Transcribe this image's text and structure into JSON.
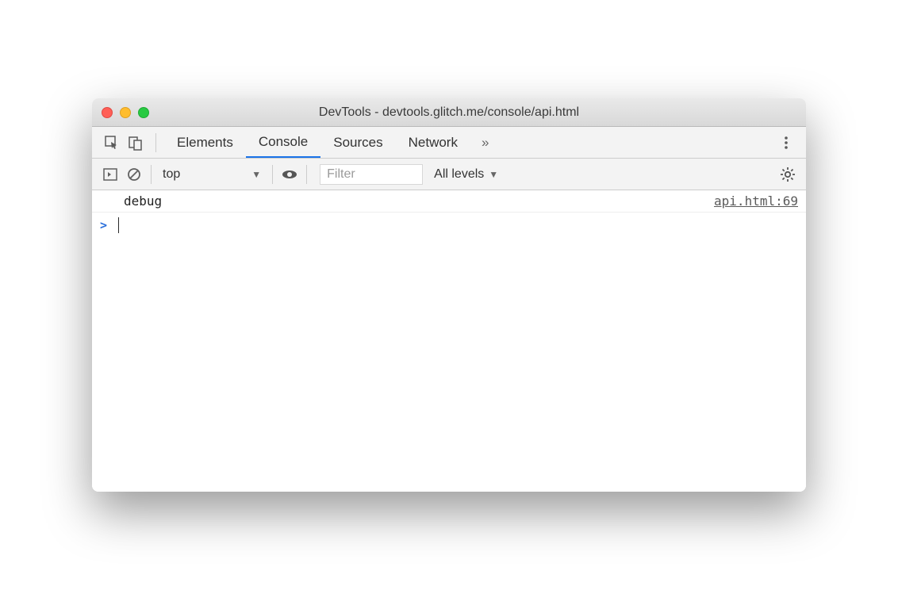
{
  "window": {
    "title": "DevTools - devtools.glitch.me/console/api.html"
  },
  "tabs": {
    "items": [
      {
        "label": "Elements",
        "active": false
      },
      {
        "label": "Console",
        "active": true
      },
      {
        "label": "Sources",
        "active": false
      },
      {
        "label": "Network",
        "active": false
      }
    ],
    "more": "»"
  },
  "filterbar": {
    "context": "top",
    "filter_placeholder": "Filter",
    "filter_value": "",
    "levels_label": "All levels"
  },
  "console": {
    "logs": [
      {
        "message": "debug",
        "source": "api.html:69"
      }
    ],
    "prompt": ">"
  }
}
